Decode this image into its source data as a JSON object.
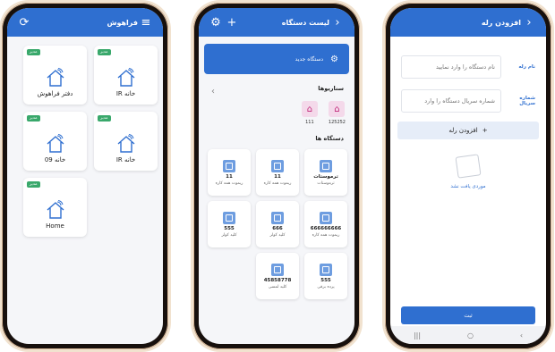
{
  "phone1": {
    "title": "فراهوش",
    "menu_icon": "menu-icon",
    "refresh_icon": "refresh-icon",
    "homes": [
      {
        "badge": "مدیر",
        "name": "دفتر فراهوش"
      },
      {
        "badge": "مدیر",
        "name": "خانه IR"
      },
      {
        "badge": "مدیر",
        "name": "خانه 09"
      },
      {
        "badge": "مدیر",
        "name": "خانه IR"
      },
      {
        "badge": "مدیر",
        "name": "Home"
      }
    ]
  },
  "phone2": {
    "title": "لیست دستگاه",
    "new_device": "دستگاه جدید",
    "scenarios_title": "سناریوها",
    "scenarios": [
      "111",
      "125252"
    ],
    "devices_title": "دستگاه ها",
    "devices": [
      {
        "title": "ترموستات",
        "sub": "ترموستات"
      },
      {
        "title": "11",
        "sub": "ریموت همه کاره"
      },
      {
        "title": "11",
        "sub": "ریموت همه کاره"
      },
      {
        "title": "666666666",
        "sub": "ریموت همه کاره"
      },
      {
        "title": "666",
        "sub": "کلید کولر"
      },
      {
        "title": "555",
        "sub": "کلید کولر"
      },
      {
        "title": "555",
        "sub": "پرده برقی"
      },
      {
        "title": "45858778",
        "sub": "کلید لمسی"
      }
    ]
  },
  "phone3": {
    "title": "افزودن رله",
    "name_label": "نام رله",
    "name_placeholder": "نام دستگاه را وارد نمایید",
    "serial_label": "شماره سریال",
    "serial_placeholder": "شماره سریال دستگاه را وارد",
    "add_button": "افزودن رله",
    "empty_text": "موردی یافت نشد",
    "submit": "ثبت"
  }
}
